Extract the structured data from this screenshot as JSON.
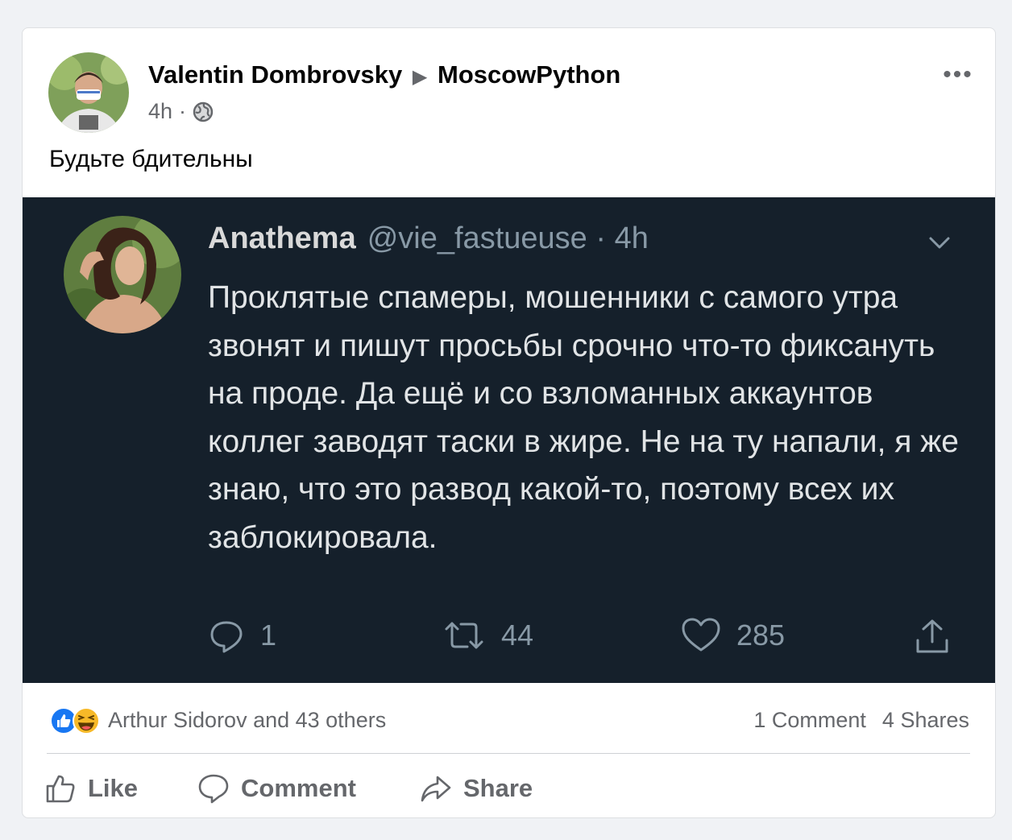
{
  "post": {
    "author": "Valentin Dombrovsky",
    "group": "MoscowPython",
    "time": "4h",
    "separator": "·",
    "text": "Будьте бдительны"
  },
  "tweet": {
    "name": "Anathema",
    "handle": "@vie_fastueuse",
    "time": "4h",
    "text": "Проклятые спамеры, мошенники с самого утра звонят и пишут просьбы срочно что-то фиксануть на проде. Да ещё и со взломанных аккаунтов коллег заводят таски в жире. Не на ту напали, я же знаю, что это развод какой-то, поэтому всех их заблокировала.",
    "replies": "1",
    "retweets": "44",
    "likes": "285"
  },
  "reactions": {
    "summary": "Arthur Sidorov and 43 others",
    "comments": "1 Comment",
    "shares": "4 Shares",
    "icons": [
      "like-icon",
      "haha-icon"
    ]
  },
  "actions": {
    "like": "Like",
    "comment": "Comment",
    "share": "Share"
  },
  "colors": {
    "tweet_bg": "#15202b",
    "like_blue": "#1877f2",
    "haha_yellow": "#f7b928",
    "muted": "#65676b"
  }
}
